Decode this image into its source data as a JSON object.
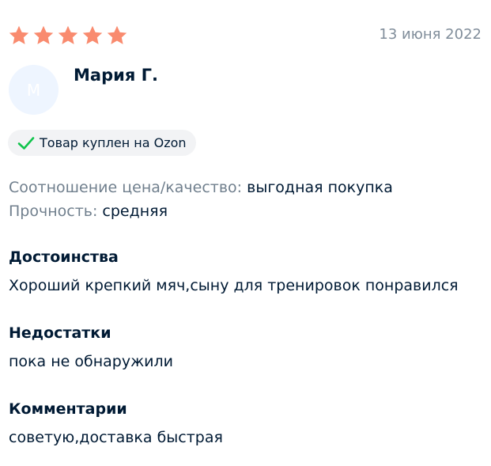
{
  "review": {
    "rating": 5,
    "rating_max": 5,
    "date": "13 июня 2022",
    "author": {
      "name": "Мария Г.",
      "avatar_initial": "М"
    },
    "badge": {
      "text": "Товар куплен на Ozon",
      "icon": "checkmark-icon"
    },
    "params": [
      {
        "key": "Соотношение цена/качество:",
        "value": "выгодная покупка"
      },
      {
        "key": "Прочность:",
        "value": "средняя"
      }
    ],
    "sections": [
      {
        "title": "Достоинства",
        "text": "Хороший крепкий мяч,сыну для тренировок понравился"
      },
      {
        "title": "Недостатки",
        "text": "пока не обнаружили"
      },
      {
        "title": "Комментарии",
        "text": "советую,доставка быстрая"
      }
    ]
  },
  "colors": {
    "star": "#f98b6f",
    "check": "#10c44c",
    "muted": "#707f8d",
    "text": "#001a34",
    "avatar_bg": "#eef5ff",
    "badge_bg": "#f2f3f5"
  }
}
